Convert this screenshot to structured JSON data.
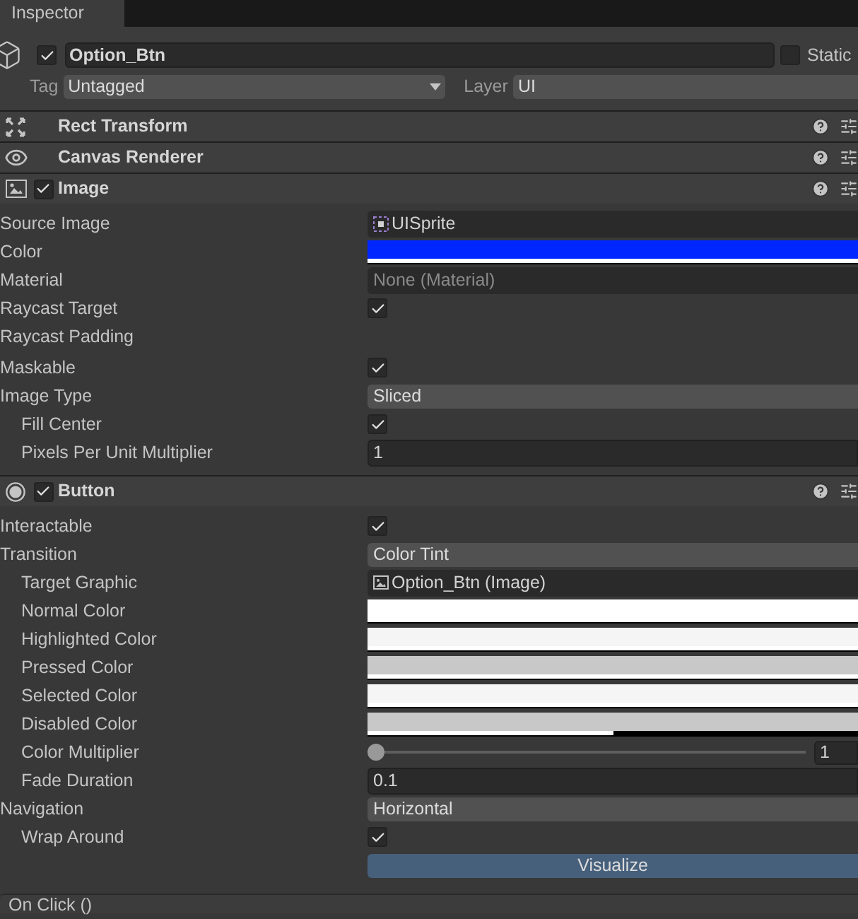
{
  "tab": {
    "label": "Inspector"
  },
  "object": {
    "active": true,
    "name": "Option_Btn",
    "static": false,
    "static_label": "Static",
    "tag_label": "Tag",
    "tag": "Untagged",
    "layer_label": "Layer",
    "layer": "UI"
  },
  "components": [
    {
      "kind": "rect_transform",
      "title": "Rect Transform"
    },
    {
      "kind": "canvas_renderer",
      "title": "Canvas Renderer"
    },
    {
      "kind": "image",
      "title": "Image",
      "enabled": true,
      "properties": [
        {
          "kind": "sprite_object",
          "label": "Source Image",
          "value": "UISprite"
        },
        {
          "kind": "color",
          "label": "Color",
          "color": "#0026ff",
          "level": 1
        },
        {
          "kind": "object",
          "label": "Material",
          "placeholder": "None (Material)"
        },
        {
          "kind": "checkbox",
          "label": "Raycast Target",
          "checked": true
        },
        {
          "kind": "label",
          "label": "Raycast Padding"
        },
        {
          "kind": "checkbox",
          "label": "Maskable",
          "checked": true
        },
        {
          "kind": "dropdown",
          "label": "Image Type",
          "value": "Sliced",
          "children": [
            {
              "kind": "checkbox",
              "label": "Fill Center",
              "checked": true
            },
            {
              "kind": "number",
              "label": "Pixels Per Unit Multiplier",
              "value": "1"
            }
          ]
        }
      ]
    },
    {
      "kind": "button",
      "title": "Button",
      "enabled": true,
      "properties": [
        {
          "kind": "checkbox",
          "label": "Interactable",
          "checked": true
        },
        {
          "kind": "dropdown",
          "label": "Transition",
          "value": "Color Tint",
          "children": [
            {
              "kind": "image_object",
              "label": "Target Graphic",
              "value": "Option_Btn (Image)"
            },
            {
              "kind": "color",
              "label": "Normal Color",
              "color": "#ffffff",
              "level": 1
            },
            {
              "kind": "color",
              "label": "Highlighted Color",
              "color": "#f5f5f5",
              "level": 1
            },
            {
              "kind": "color",
              "label": "Pressed Color",
              "color": "#c8c8c8",
              "level": 1
            },
            {
              "kind": "color",
              "label": "Selected Color",
              "color": "#f5f5f5",
              "level": 1
            },
            {
              "kind": "color",
              "label": "Disabled Color",
              "color": "#c8c8c8",
              "level": 0.5
            },
            {
              "kind": "slider",
              "label": "Color Multiplier",
              "level": 0,
              "value": "1"
            },
            {
              "kind": "number",
              "label": "Fade Duration",
              "value": "0.1"
            }
          ]
        },
        {
          "kind": "dropdown",
          "label": "Navigation",
          "value": "Horizontal",
          "children": [
            {
              "kind": "checkbox",
              "label": "Wrap Around",
              "checked": true
            }
          ]
        },
        {
          "kind": "button",
          "label": "Visualize"
        }
      ]
    }
  ],
  "event": {
    "title": "On Click ()"
  }
}
